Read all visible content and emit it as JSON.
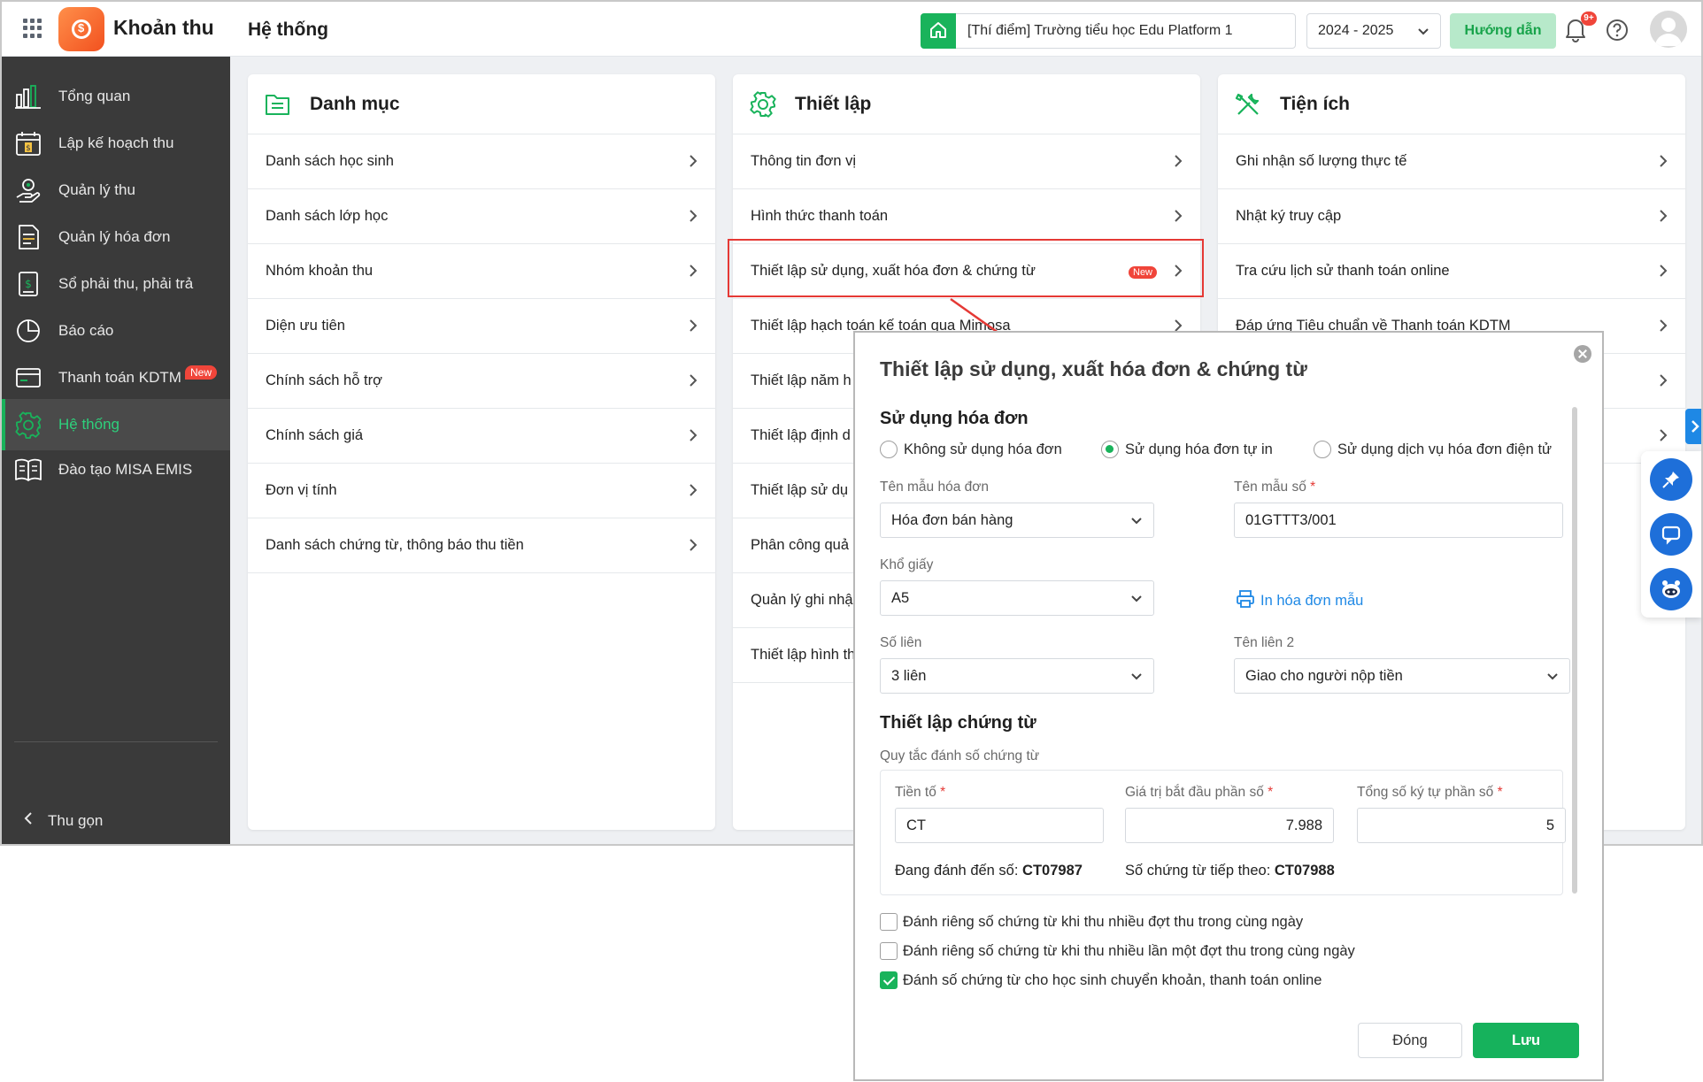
{
  "app": {
    "name": "Khoản thu",
    "page_title": "Hệ thống"
  },
  "header": {
    "school": "[Thí điểm] Trường tiểu học Edu Platform 1",
    "year": "2024 - 2025",
    "guide_label": "Hướng dẫn",
    "notification_badge": "9+"
  },
  "sidebar": {
    "items": [
      {
        "label": "Tổng quan",
        "icon": "bar-chart-icon"
      },
      {
        "label": "Lập kế hoạch thu",
        "icon": "calendar-money-icon"
      },
      {
        "label": "Quản lý thu",
        "icon": "hand-coin-icon"
      },
      {
        "label": "Quản lý hóa đơn",
        "icon": "invoice-icon"
      },
      {
        "label": "Sổ phải thu, phải trả",
        "icon": "ledger-icon"
      },
      {
        "label": "Báo cáo",
        "icon": "pie-chart-icon"
      },
      {
        "label": "Thanh toán KDTM",
        "icon": "card-icon",
        "badge": "New"
      },
      {
        "label": "Hệ thống",
        "icon": "gear-icon",
        "active": true
      },
      {
        "label": "Đào tạo MISA EMIS",
        "icon": "book-icon"
      }
    ],
    "collapse_label": "Thu gọn"
  },
  "cards": [
    {
      "title": "Danh mục",
      "items": [
        "Danh sách học sinh",
        "Danh sách lớp học",
        "Nhóm khoản thu",
        "Diện ưu tiên",
        "Chính sách hỗ trợ",
        "Chính sách giá",
        "Đơn vị tính",
        "Danh sách chứng từ, thông báo thu tiền"
      ]
    },
    {
      "title": "Thiết lập",
      "items": [
        "Thông tin đơn vị",
        "Hình thức thanh toán",
        "Thiết lập sử dụng, xuất hóa đơn & chứng từ",
        "Thiết lập hạch toán kế toán qua Mimosa",
        "Thiết lập năm h",
        "Thiết lập định d",
        "Thiết lập sử dụ",
        "Phân công quả",
        "Quản lý ghi nhậ",
        "Thiết lập hình th"
      ],
      "new_badge": "New"
    },
    {
      "title": "Tiện ích",
      "items": [
        "Ghi nhận số lượng thực tế",
        "Nhật ký truy cập",
        "Tra cứu lịch sử thanh toán online",
        "Đáp ứng Tiêu chuẩn về Thanh toán KDTM"
      ]
    }
  ],
  "dialog": {
    "title": "Thiết lập sử dụng, xuất hóa đơn & chứng từ",
    "invoice_section": "Sử dụng hóa đơn",
    "radios": [
      {
        "label": "Không sử dụng hóa đơn",
        "checked": false
      },
      {
        "label": "Sử dụng hóa đơn tự in",
        "checked": true
      },
      {
        "label": "Sử dụng dịch vụ hóa đơn điện tử",
        "checked": false
      }
    ],
    "template_name_label": "Tên mẫu hóa đơn",
    "template_name_value": "Hóa đơn bán hàng",
    "template_code_label": "Tên mẫu số",
    "template_code_value": "01GTTT3/001",
    "paper_label": "Khổ giấy",
    "paper_value": "A5",
    "print_sample_label": "In hóa đơn mẫu",
    "copies_label": "Số liên",
    "copies_value": "3 liên",
    "copy2_label": "Tên liên 2",
    "copy2_value": "Giao cho người nộp tiền",
    "voucher_section": "Thiết lập chứng từ",
    "numbering_rule_label": "Quy tắc đánh số chứng từ",
    "prefix_label": "Tiền tố",
    "prefix_value": "CT",
    "start_label": "Giá trị bắt đầu phần số",
    "start_value": "7.988",
    "digits_label": "Tổng số ký tự phần số",
    "digits_value": "5",
    "current_label": "Đang đánh đến số:",
    "current_value": "CT07987",
    "next_label": "Số chứng từ tiếp theo:",
    "next_value": "CT07988",
    "checkboxes": [
      {
        "label": "Đánh riêng số chứng từ khi thu nhiều đợt thu trong cùng ngày",
        "checked": false
      },
      {
        "label": "Đánh riêng số chứng từ khi thu nhiều lần một đợt thu trong cùng ngày",
        "checked": false
      },
      {
        "label": "Đánh số chứng từ cho học sinh chuyển khoản, thanh toán online",
        "checked": true
      }
    ],
    "close_label": "Đóng",
    "save_label": "Lưu"
  },
  "colors": {
    "brand_green": "#19b35b",
    "sidebar_bg": "#3a3a3a",
    "highlight_red": "#e53935",
    "link_blue": "#1e88e5"
  }
}
